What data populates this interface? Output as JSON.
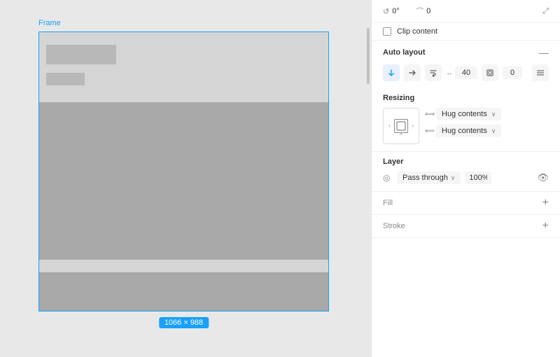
{
  "canvas": {
    "background": "#e8e8e8",
    "frame": {
      "label": "Frame",
      "dimension": "1066 × 988"
    }
  },
  "panel": {
    "top_controls": {
      "rotation_icon": "rotate-icon",
      "rotation_value": "0°",
      "corner_icon": "corner-radius-icon",
      "corner_value": "0",
      "expand_icon": "expand-icon"
    },
    "clip_content": {
      "label": "Clip content"
    },
    "auto_layout": {
      "title": "Auto layout",
      "action": "—",
      "direction_down": "↓",
      "direction_right": "→",
      "wrap_icon": "wrap-icon",
      "gap_value": "40",
      "padding_icon": "padding-icon",
      "padding_value": "0",
      "align_icon": "align-icon"
    },
    "resizing": {
      "title": "Resizing",
      "horizontal_label": "Hug contents",
      "vertical_label": "Hug contents"
    },
    "layer": {
      "title": "Layer",
      "blend_mode": "Pass through",
      "opacity": "100%"
    },
    "fill": {
      "title": "Fill",
      "add_label": "+"
    },
    "stroke": {
      "title": "Stroke",
      "add_label": "+"
    }
  }
}
